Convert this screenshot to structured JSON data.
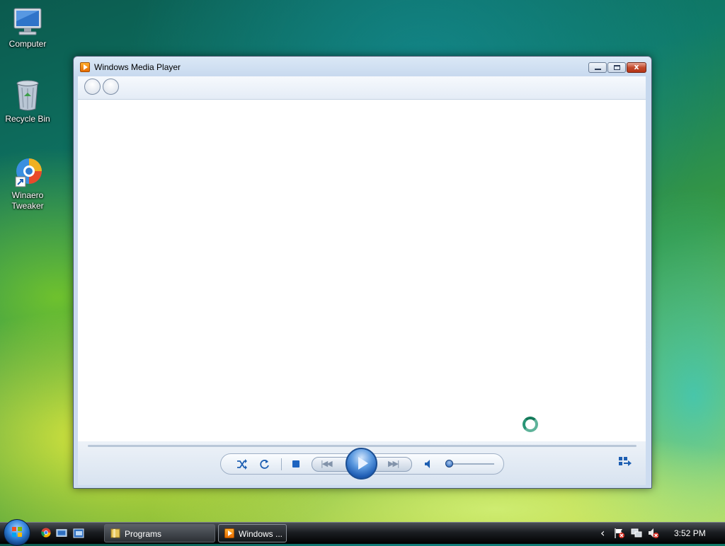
{
  "desktop": {
    "icons": [
      {
        "label": "Computer",
        "icon": "computer-icon"
      },
      {
        "label": "Recycle Bin",
        "icon": "recycle-bin-icon"
      },
      {
        "label_line1": "Winaero",
        "label_line2": "Tweaker",
        "icon": "winaero-tweaker-icon"
      }
    ]
  },
  "window": {
    "title": "Windows Media Player",
    "icon": "media-player-icon",
    "caption_buttons": [
      "minimize",
      "maximize",
      "close"
    ],
    "close_glyph": "x"
  },
  "navigation": {
    "back": "back-icon",
    "forward": "forward-icon"
  },
  "player_controls": {
    "shuffle": "shuffle-icon",
    "repeat": "repeat-icon",
    "stop": "stop-icon",
    "previous_glyph": "|◀◀",
    "next_glyph": "▶▶|",
    "play": "play-icon",
    "mute": "speaker-icon",
    "volume": 0.0,
    "switch_view": "switch-to-now-playing-icon"
  },
  "taskbar": {
    "start": "start-orb-icon",
    "quick_launch": [
      "chrome-icon",
      "show-desktop-icon",
      "switch-windows-icon"
    ],
    "buttons": [
      {
        "label": "Programs",
        "icon": "folder-icon",
        "active": false
      },
      {
        "label": "Windows ...",
        "icon": "media-player-icon",
        "active": true
      }
    ],
    "tray": {
      "expand_glyph": "‹",
      "icons": [
        "action-center-flag-icon",
        "network-icon",
        "volume-muted-icon"
      ],
      "time": "3:52 PM"
    }
  }
}
